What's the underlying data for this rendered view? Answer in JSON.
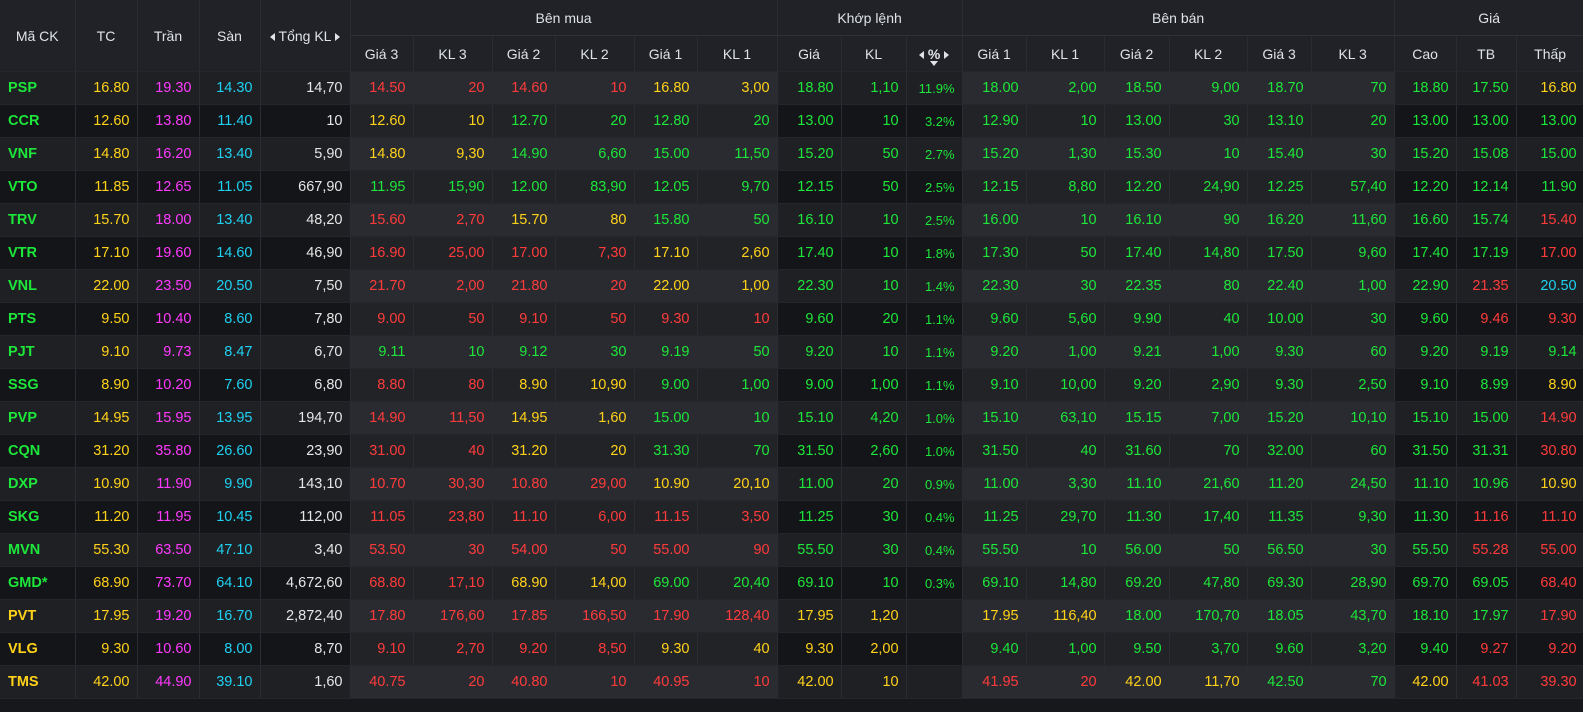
{
  "colors": {
    "up": "#1de73a",
    "down": "#ff3b3b",
    "ref": "#ffd21a",
    "ceil": "#ff3aff",
    "floor": "#1fd1f2",
    "white": "#e6e6e6"
  },
  "headers": {
    "symbol": "Mã CK",
    "ref": "TC",
    "ceiling": "Trần",
    "floor": "Sàn",
    "total_vol": "Tổng KL",
    "buy_group": "Bên mua",
    "match_group": "Khớp lệnh",
    "sell_group": "Bên bán",
    "price_group": "Giá",
    "buy": {
      "p3": "Giá 3",
      "v3": "KL 3",
      "p2": "Giá 2",
      "v2": "KL 2",
      "p1": "Giá 1",
      "v1": "KL 1"
    },
    "match": {
      "price": "Giá",
      "vol": "KL",
      "pct": "%"
    },
    "sell": {
      "p1": "Giá 1",
      "v1": "KL 1",
      "p2": "Giá 2",
      "v2": "KL 2",
      "p3": "Giá 3",
      "v3": "KL 3"
    },
    "price": {
      "high": "Cao",
      "avg": "TB",
      "low": "Thấp"
    }
  },
  "rows": [
    {
      "sym": "PSP",
      "tc": "16.80",
      "tran": "19.30",
      "san": "14.30",
      "tkl": "14,70",
      "b3": "14.50",
      "bv3": "20",
      "b2": "14.60",
      "bv2": "10",
      "b1": "16.80",
      "bv1": "3,00",
      "mp": "18.80",
      "mv": "1,10",
      "pct": "11.9%",
      "s1": "18.00",
      "sv1": "2,00",
      "s2": "18.50",
      "sv2": "9,00",
      "s3": "18.70",
      "sv3": "70",
      "hi": "18.80",
      "avg": "17.50",
      "lo": "16.80"
    },
    {
      "sym": "CCR",
      "tc": "12.60",
      "tran": "13.80",
      "san": "11.40",
      "tkl": "10",
      "b3": "12.60",
      "bv3": "10",
      "b2": "12.70",
      "bv2": "20",
      "b1": "12.80",
      "bv1": "20",
      "mp": "13.00",
      "mv": "10",
      "pct": "3.2%",
      "s1": "12.90",
      "sv1": "10",
      "s2": "13.00",
      "sv2": "30",
      "s3": "13.10",
      "sv3": "20",
      "hi": "13.00",
      "avg": "13.00",
      "lo": "13.00"
    },
    {
      "sym": "VNF",
      "tc": "14.80",
      "tran": "16.20",
      "san": "13.40",
      "tkl": "5,90",
      "b3": "14.80",
      "bv3": "9,30",
      "b2": "14.90",
      "bv2": "6,60",
      "b1": "15.00",
      "bv1": "11,50",
      "mp": "15.20",
      "mv": "50",
      "pct": "2.7%",
      "s1": "15.20",
      "sv1": "1,30",
      "s2": "15.30",
      "sv2": "10",
      "s3": "15.40",
      "sv3": "30",
      "hi": "15.20",
      "avg": "15.08",
      "lo": "15.00"
    },
    {
      "sym": "VTO",
      "tc": "11.85",
      "tran": "12.65",
      "san": "11.05",
      "tkl": "667,90",
      "b3": "11.95",
      "bv3": "15,90",
      "b2": "12.00",
      "bv2": "83,90",
      "b1": "12.05",
      "bv1": "9,70",
      "mp": "12.15",
      "mv": "50",
      "pct": "2.5%",
      "s1": "12.15",
      "sv1": "8,80",
      "s2": "12.20",
      "sv2": "24,90",
      "s3": "12.25",
      "sv3": "57,40",
      "hi": "12.20",
      "avg": "12.14",
      "lo": "11.90"
    },
    {
      "sym": "TRV",
      "tc": "15.70",
      "tran": "18.00",
      "san": "13.40",
      "tkl": "48,20",
      "b3": "15.60",
      "bv3": "2,70",
      "b2": "15.70",
      "bv2": "80",
      "b1": "15.80",
      "bv1": "50",
      "mp": "16.10",
      "mv": "10",
      "pct": "2.5%",
      "s1": "16.00",
      "sv1": "10",
      "s2": "16.10",
      "sv2": "90",
      "s3": "16.20",
      "sv3": "11,60",
      "hi": "16.60",
      "avg": "15.74",
      "lo": "15.40"
    },
    {
      "sym": "VTR",
      "tc": "17.10",
      "tran": "19.60",
      "san": "14.60",
      "tkl": "46,90",
      "b3": "16.90",
      "bv3": "25,00",
      "b2": "17.00",
      "bv2": "7,30",
      "b1": "17.10",
      "bv1": "2,60",
      "mp": "17.40",
      "mv": "10",
      "pct": "1.8%",
      "s1": "17.30",
      "sv1": "50",
      "s2": "17.40",
      "sv2": "14,80",
      "s3": "17.50",
      "sv3": "9,60",
      "hi": "17.40",
      "avg": "17.19",
      "lo": "17.00"
    },
    {
      "sym": "VNL",
      "tc": "22.00",
      "tran": "23.50",
      "san": "20.50",
      "tkl": "7,50",
      "b3": "21.70",
      "bv3": "2,00",
      "b2": "21.80",
      "bv2": "20",
      "b1": "22.00",
      "bv1": "1,00",
      "mp": "22.30",
      "mv": "10",
      "pct": "1.4%",
      "s1": "22.30",
      "sv1": "30",
      "s2": "22.35",
      "sv2": "80",
      "s3": "22.40",
      "sv3": "1,00",
      "hi": "22.90",
      "avg": "21.35",
      "lo": "20.50"
    },
    {
      "sym": "PTS",
      "tc": "9.50",
      "tran": "10.40",
      "san": "8.60",
      "tkl": "7,80",
      "b3": "9.00",
      "bv3": "50",
      "b2": "9.10",
      "bv2": "50",
      "b1": "9.30",
      "bv1": "10",
      "mp": "9.60",
      "mv": "20",
      "pct": "1.1%",
      "s1": "9.60",
      "sv1": "5,60",
      "s2": "9.90",
      "sv2": "40",
      "s3": "10.00",
      "sv3": "30",
      "hi": "9.60",
      "avg": "9.46",
      "lo": "9.30"
    },
    {
      "sym": "PJT",
      "tc": "9.10",
      "tran": "9.73",
      "san": "8.47",
      "tkl": "6,70",
      "b3": "9.11",
      "bv3": "10",
      "b2": "9.12",
      "bv2": "30",
      "b1": "9.19",
      "bv1": "50",
      "mp": "9.20",
      "mv": "10",
      "pct": "1.1%",
      "s1": "9.20",
      "sv1": "1,00",
      "s2": "9.21",
      "sv2": "1,00",
      "s3": "9.30",
      "sv3": "60",
      "hi": "9.20",
      "avg": "9.19",
      "lo": "9.14"
    },
    {
      "sym": "SSG",
      "tc": "8.90",
      "tran": "10.20",
      "san": "7.60",
      "tkl": "6,80",
      "b3": "8.80",
      "bv3": "80",
      "b2": "8.90",
      "bv2": "10,90",
      "b1": "9.00",
      "bv1": "1,00",
      "mp": "9.00",
      "mv": "1,00",
      "pct": "1.1%",
      "s1": "9.10",
      "sv1": "10,00",
      "s2": "9.20",
      "sv2": "2,90",
      "s3": "9.30",
      "sv3": "2,50",
      "hi": "9.10",
      "avg": "8.99",
      "lo": "8.90"
    },
    {
      "sym": "PVP",
      "tc": "14.95",
      "tran": "15.95",
      "san": "13.95",
      "tkl": "194,70",
      "b3": "14.90",
      "bv3": "11,50",
      "b2": "14.95",
      "bv2": "1,60",
      "b1": "15.00",
      "bv1": "10",
      "mp": "15.10",
      "mv": "4,20",
      "pct": "1.0%",
      "s1": "15.10",
      "sv1": "63,10",
      "s2": "15.15",
      "sv2": "7,00",
      "s3": "15.20",
      "sv3": "10,10",
      "hi": "15.10",
      "avg": "15.00",
      "lo": "14.90"
    },
    {
      "sym": "CQN",
      "tc": "31.20",
      "tran": "35.80",
      "san": "26.60",
      "tkl": "23,90",
      "b3": "31.00",
      "bv3": "40",
      "b2": "31.20",
      "bv2": "20",
      "b1": "31.30",
      "bv1": "70",
      "mp": "31.50",
      "mv": "2,60",
      "pct": "1.0%",
      "s1": "31.50",
      "sv1": "40",
      "s2": "31.60",
      "sv2": "70",
      "s3": "32.00",
      "sv3": "60",
      "hi": "31.50",
      "avg": "31.31",
      "lo": "30.80"
    },
    {
      "sym": "DXP",
      "tc": "10.90",
      "tran": "11.90",
      "san": "9.90",
      "tkl": "143,10",
      "b3": "10.70",
      "bv3": "30,30",
      "b2": "10.80",
      "bv2": "29,00",
      "b1": "10.90",
      "bv1": "20,10",
      "mp": "11.00",
      "mv": "20",
      "pct": "0.9%",
      "s1": "11.00",
      "sv1": "3,30",
      "s2": "11.10",
      "sv2": "21,60",
      "s3": "11.20",
      "sv3": "24,50",
      "hi": "11.10",
      "avg": "10.96",
      "lo": "10.90"
    },
    {
      "sym": "SKG",
      "tc": "11.20",
      "tran": "11.95",
      "san": "10.45",
      "tkl": "112,00",
      "b3": "11.05",
      "bv3": "23,80",
      "b2": "11.10",
      "bv2": "6,00",
      "b1": "11.15",
      "bv1": "3,50",
      "mp": "11.25",
      "mv": "30",
      "pct": "0.4%",
      "s1": "11.25",
      "sv1": "29,70",
      "s2": "11.30",
      "sv2": "17,40",
      "s3": "11.35",
      "sv3": "9,30",
      "hi": "11.30",
      "avg": "11.16",
      "lo": "11.10"
    },
    {
      "sym": "MVN",
      "tc": "55.30",
      "tran": "63.50",
      "san": "47.10",
      "tkl": "3,40",
      "b3": "53.50",
      "bv3": "30",
      "b2": "54.00",
      "bv2": "50",
      "b1": "55.00",
      "bv1": "90",
      "mp": "55.50",
      "mv": "30",
      "pct": "0.4%",
      "s1": "55.50",
      "sv1": "10",
      "s2": "56.00",
      "sv2": "50",
      "s3": "56.50",
      "sv3": "30",
      "hi": "55.50",
      "avg": "55.28",
      "lo": "55.00"
    },
    {
      "sym": "GMD*",
      "tc": "68.90",
      "tran": "73.70",
      "san": "64.10",
      "tkl": "4,672,60",
      "b3": "68.80",
      "bv3": "17,10",
      "b2": "68.90",
      "bv2": "14,00",
      "b1": "69.00",
      "bv1": "20,40",
      "mp": "69.10",
      "mv": "10",
      "pct": "0.3%",
      "s1": "69.10",
      "sv1": "14,80",
      "s2": "69.20",
      "sv2": "47,80",
      "s3": "69.30",
      "sv3": "28,90",
      "hi": "69.70",
      "avg": "69.05",
      "lo": "68.40"
    },
    {
      "sym": "PVT",
      "tc": "17.95",
      "tran": "19.20",
      "san": "16.70",
      "tkl": "2,872,40",
      "b3": "17.80",
      "bv3": "176,60",
      "b2": "17.85",
      "bv2": "166,50",
      "b1": "17.90",
      "bv1": "128,40",
      "mp": "17.95",
      "mv": "1,20",
      "pct": "",
      "s1": "17.95",
      "sv1": "116,40",
      "s2": "18.00",
      "sv2": "170,70",
      "s3": "18.05",
      "sv3": "43,70",
      "hi": "18.10",
      "avg": "17.97",
      "lo": "17.90"
    },
    {
      "sym": "VLG",
      "tc": "9.30",
      "tran": "10.60",
      "san": "8.00",
      "tkl": "8,70",
      "b3": "9.10",
      "bv3": "2,70",
      "b2": "9.20",
      "bv2": "8,50",
      "b1": "9.30",
      "bv1": "40",
      "mp": "9.30",
      "mv": "2,00",
      "pct": "",
      "s1": "9.40",
      "sv1": "1,00",
      "s2": "9.50",
      "sv2": "3,70",
      "s3": "9.60",
      "sv3": "3,20",
      "hi": "9.40",
      "avg": "9.27",
      "lo": "9.20"
    },
    {
      "sym": "TMS",
      "tc": "42.00",
      "tran": "44.90",
      "san": "39.10",
      "tkl": "1,60",
      "b3": "40.75",
      "bv3": "20",
      "b2": "40.80",
      "bv2": "10",
      "b1": "40.95",
      "bv1": "10",
      "mp": "42.00",
      "mv": "10",
      "pct": "",
      "s1": "41.95",
      "sv1": "20",
      "s2": "42.00",
      "sv2": "11,70",
      "s3": "42.50",
      "sv3": "70",
      "hi": "42.00",
      "avg": "41.03",
      "lo": "39.30"
    }
  ]
}
